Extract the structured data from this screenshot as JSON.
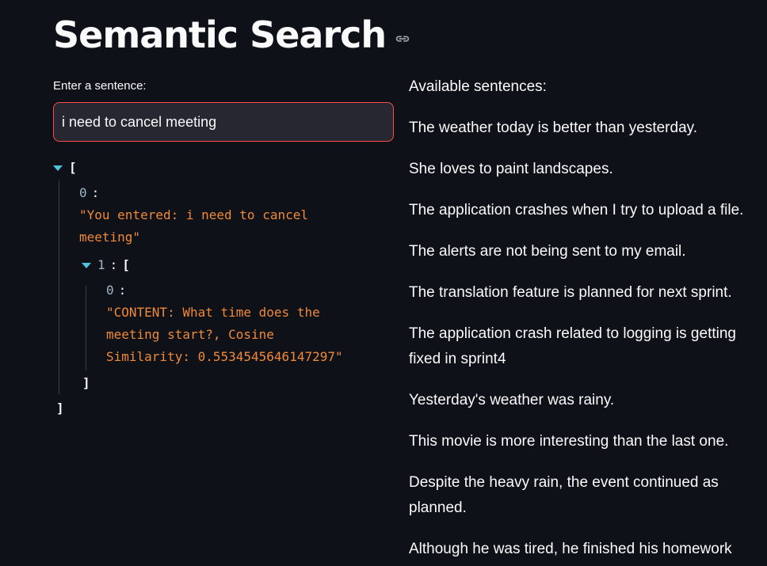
{
  "header": {
    "title": "Semantic Search",
    "link_icon": "link-icon"
  },
  "input": {
    "label": "Enter a sentence:",
    "value": "i need to cancel meeting"
  },
  "json_view": {
    "open_bracket": "[",
    "close_bracket": "]",
    "item0_key": "0",
    "item0_line1": "\"You entered: i need to cancel",
    "item0_line2": "meeting\"",
    "item1_key": "1",
    "item1_open": "[",
    "item1_close": "]",
    "nested0_key": "0",
    "nested0_line1": "\"CONTENT: What time does the",
    "nested0_line2": "meeting start?, Cosine",
    "nested0_line3": "Similarity: 0.5534545646147297\"",
    "colon": ":",
    "caret_color": "#4fc3dc",
    "string_color": "#f0893a"
  },
  "sentences": {
    "heading": "Available sentences:",
    "items": [
      "The weather today is better than yesterday.",
      "She loves to paint landscapes.",
      "The application crashes when I try to upload a file.",
      "The alerts are not being sent to my email.",
      "The translation feature is planned for next sprint.",
      "The application crash related to logging is getting fixed in sprint4",
      "Yesterday's weather was rainy.",
      "This movie is more interesting than the last one.",
      "Despite the heavy rain, the event continued as planned.",
      "Although he was tired, he finished his homework"
    ]
  },
  "colors": {
    "background": "#0e1117",
    "input_border": "#ff4b4b",
    "input_bg": "#262730"
  }
}
